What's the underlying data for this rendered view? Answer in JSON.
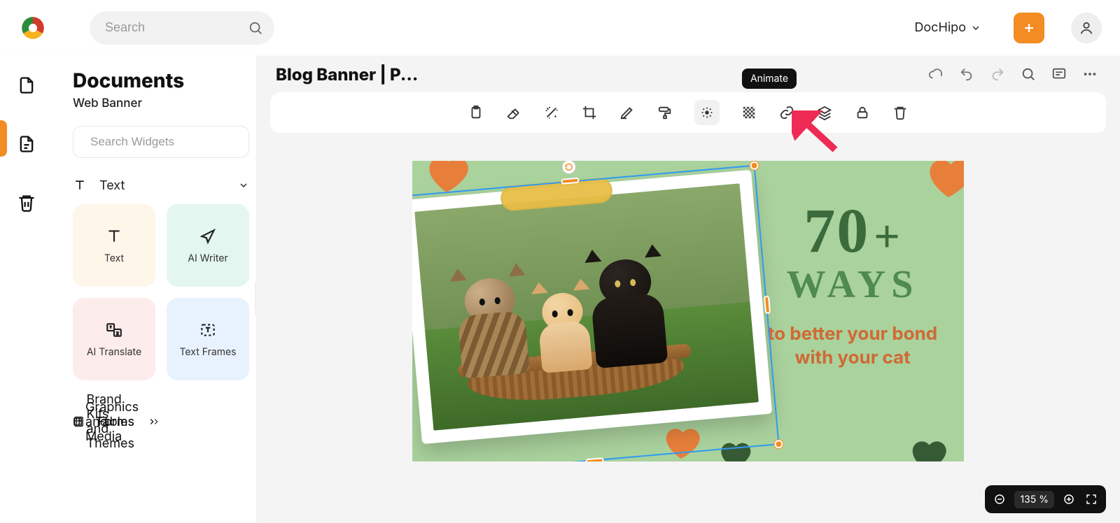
{
  "header": {
    "search_placeholder": "Search",
    "user_name": "DocHipo"
  },
  "panel": {
    "title": "Documents",
    "subtitle": "Web Banner",
    "widget_placeholder": "Search Widgets",
    "text_section": "Text",
    "tiles": {
      "text": "Text",
      "ai": "AI Writer",
      "translate": "AI Translate",
      "frames": "Text Frames"
    },
    "cats": {
      "graphics": "Graphics and Media",
      "tables": "Tables",
      "forms": "Forms",
      "brand": "Brand Kits and Themes"
    }
  },
  "doc": {
    "title": "Blog Banner | P...",
    "tooltip": "Animate"
  },
  "banner": {
    "big_number": "70",
    "plus": "+",
    "ways": "WAYS",
    "tagline": "to better your bond with your cat"
  },
  "zoom": {
    "value": "135 %"
  }
}
